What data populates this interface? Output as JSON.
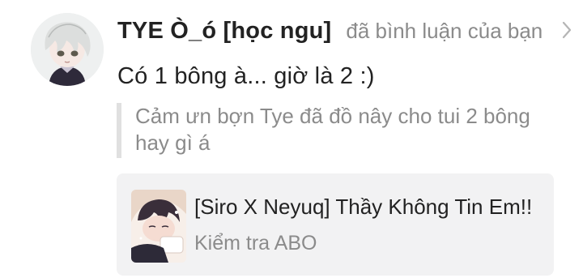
{
  "notification": {
    "user_name": "TYE Ò_ó [học ngu]",
    "action_text": "đã bình luận của bạn",
    "comment": "Có 1 bông à... giờ là 2 :)",
    "quoted_reply": "Cảm ưn bợn Tye đã đồ nây cho tui 2 bông hay gì á"
  },
  "story": {
    "title": "[Siro X Neyuq] Thầy Không Tin Em!!",
    "subtitle": "Kiểm tra ABO"
  },
  "icons": {
    "open": "chevron-right-icon"
  }
}
